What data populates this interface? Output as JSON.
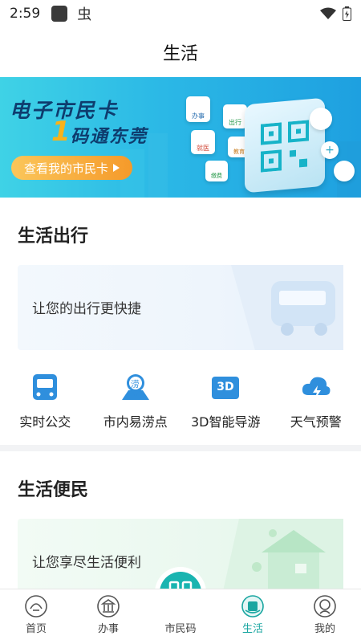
{
  "status": {
    "time": "2:59"
  },
  "header": {
    "title": "生活"
  },
  "banner": {
    "title": "电子市民卡",
    "num": "1",
    "subtitle": "码通东莞",
    "cta": "查看我的市民卡",
    "chip_labels": [
      "办事",
      "出行",
      "就医",
      "教育",
      "缴费"
    ]
  },
  "travel": {
    "title": "生活出行",
    "promo": "让您的出行更快捷",
    "shortcuts": [
      {
        "label": "实时公交",
        "icon": "bus-icon"
      },
      {
        "label": "市内易涝点",
        "icon": "flood-map-icon",
        "badge": "涝"
      },
      {
        "label": "3D智能导游",
        "icon": "3d-guide-icon",
        "badge": "3D"
      },
      {
        "label": "天气预警",
        "icon": "weather-alert-icon"
      }
    ]
  },
  "convenience": {
    "title": "生活便民",
    "promo": "让您享尽生活便利"
  },
  "tabbar": {
    "tabs": [
      {
        "label": "首页",
        "icon": "home-icon"
      },
      {
        "label": "办事",
        "icon": "service-hall-icon"
      },
      {
        "label": "市民码",
        "icon": "citizen-code-icon"
      },
      {
        "label": "生活",
        "icon": "life-icon",
        "active": true
      },
      {
        "label": "我的",
        "icon": "profile-icon"
      }
    ]
  },
  "colors": {
    "accent": "#19b4b0",
    "banner_start": "#3fd2e6",
    "banner_end": "#1ea0e0",
    "cta": "#f59a2a",
    "icon_blue": "#2f8fdd"
  }
}
